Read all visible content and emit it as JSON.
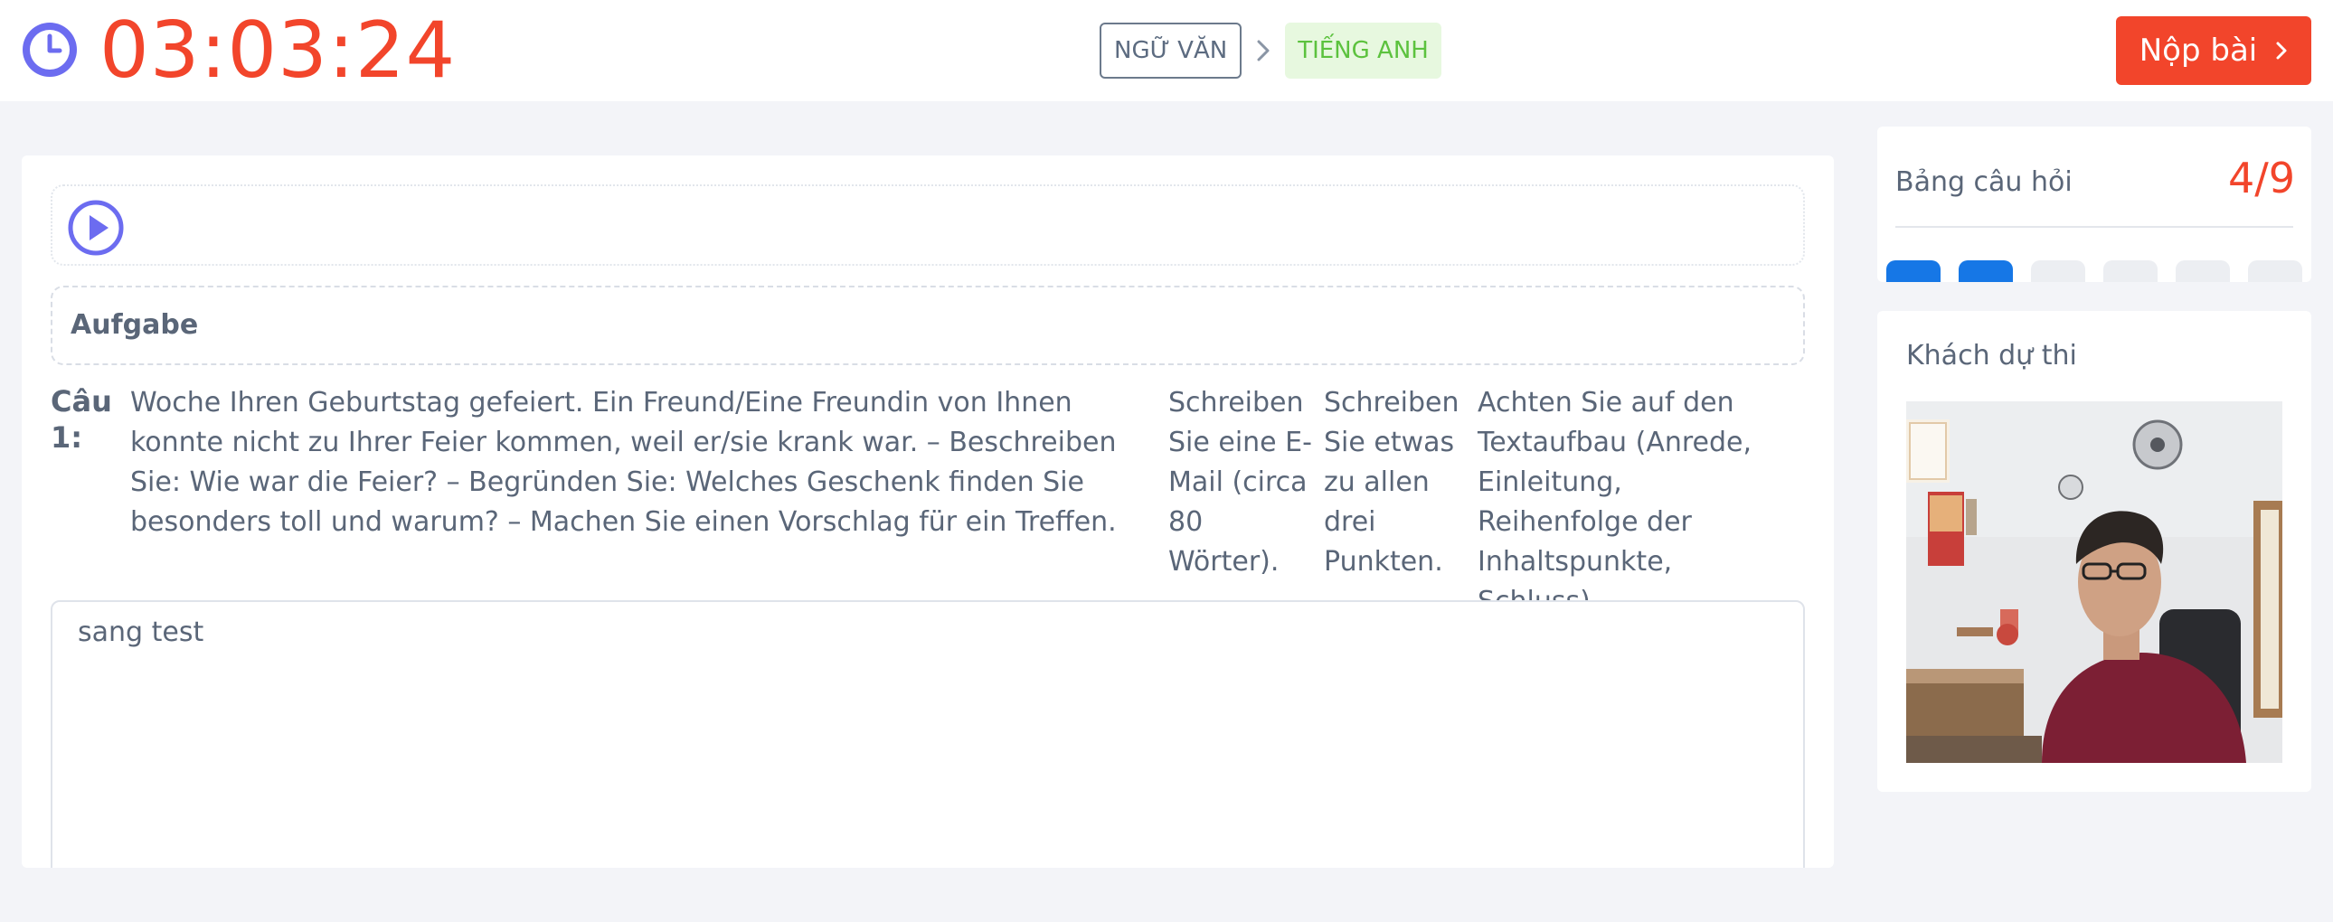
{
  "header": {
    "timer": "03:03:24",
    "breadcrumb": {
      "subject": "NGỮ VĂN",
      "current": "TIẾNG ANH"
    },
    "submit_label": "Nộp bài"
  },
  "main": {
    "task_label": "Aufgabe",
    "question_label": "Câu 1:",
    "question_columns": [
      "Woche Ihren Geburtstag gefeiert. Ein Freund/Eine Freundin von Ihnen konnte nicht zu Ihrer Feier kommen, weil er/sie krank war. – Beschreiben Sie: Wie war die Feier? – Begründen Sie: Welches Geschenk finden Sie besonders toll und warum? – Machen Sie einen Vorschlag für ein Treffen.",
      "Schreiben Sie eine E-Mail (circa 80 Wörter).",
      "Schreiben Sie etwas zu allen drei Punkten.",
      "Achten Sie auf den Textaufbau (Anrede, Einleitung, Reihenfolge der Inhaltspunkte, Schluss)."
    ],
    "answer_text": "sang test"
  },
  "question_panel": {
    "title": "Bảng câu hỏi",
    "progress": "4/9",
    "items": [
      {
        "state": "done"
      },
      {
        "state": "done"
      },
      {
        "state": "empty"
      },
      {
        "state": "empty"
      },
      {
        "state": "empty"
      },
      {
        "state": "empty"
      }
    ]
  },
  "candidate_panel": {
    "title": "Khách dự thi"
  },
  "colors": {
    "accent_red": "#f2452b",
    "clock_purple": "#6c6cf0",
    "answered_blue": "#1677e6",
    "current_green": "#5cc23e"
  }
}
